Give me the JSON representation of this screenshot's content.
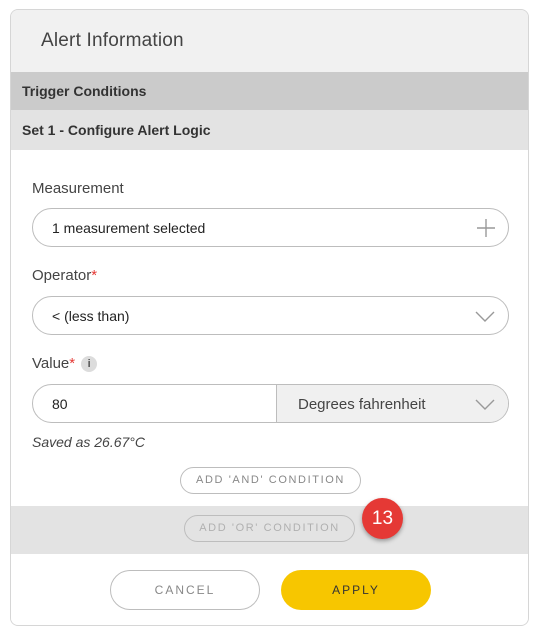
{
  "header": {
    "title": "Alert Information"
  },
  "sections": {
    "trigger_title": "Trigger Conditions",
    "set_title": "Set 1 - Configure Alert Logic"
  },
  "measurement": {
    "label": "Measurement",
    "value": "1 measurement selected",
    "icon": "plus-icon"
  },
  "operator": {
    "label": "Operator",
    "required_mark": "*",
    "value": "< (less than)",
    "icon": "chevron-down-icon"
  },
  "value_field": {
    "label": "Value",
    "required_mark": "*",
    "info_glyph": "i",
    "value": "80",
    "unit": "Degrees fahrenheit",
    "saved_note": "Saved as 26.67°C"
  },
  "conditions": {
    "add_and": "ADD 'AND' CONDITION",
    "add_or": "ADD 'OR' CONDITION"
  },
  "annotation": {
    "badge_number": "13",
    "color": "#e53935"
  },
  "footer": {
    "cancel": "CANCEL",
    "apply": "APPLY",
    "apply_color": "#f7c600"
  }
}
